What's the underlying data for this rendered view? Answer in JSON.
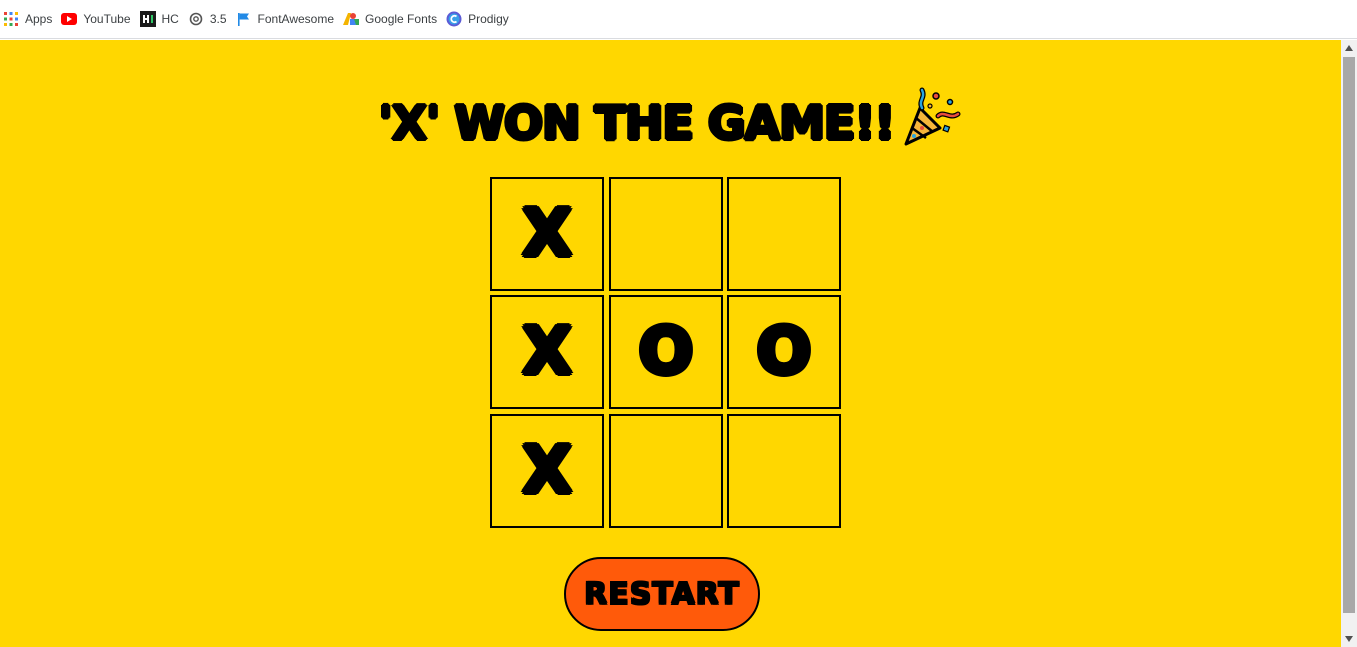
{
  "bookmarks": [
    {
      "label": "Apps",
      "icon": "apps-grid-icon"
    },
    {
      "label": "YouTube",
      "icon": "youtube-icon"
    },
    {
      "label": "HC",
      "icon": "hc-icon"
    },
    {
      "label": "3.5",
      "icon": "openai-icon"
    },
    {
      "label": "FontAwesome",
      "icon": "flag-icon"
    },
    {
      "label": "Google Fonts",
      "icon": "google-fonts-icon"
    },
    {
      "label": "Prodigy",
      "icon": "prodigy-icon"
    }
  ],
  "game": {
    "heading": "'X' WON THE GAME!!",
    "heading_icon": "party-popper-icon",
    "board": [
      "X",
      "",
      "",
      "X",
      "O",
      "O",
      "X",
      "",
      ""
    ],
    "restart_label": "RESTART"
  },
  "colors": {
    "background": "#ffd700",
    "restart_button": "#ff5a0a",
    "ink": "#000000"
  }
}
